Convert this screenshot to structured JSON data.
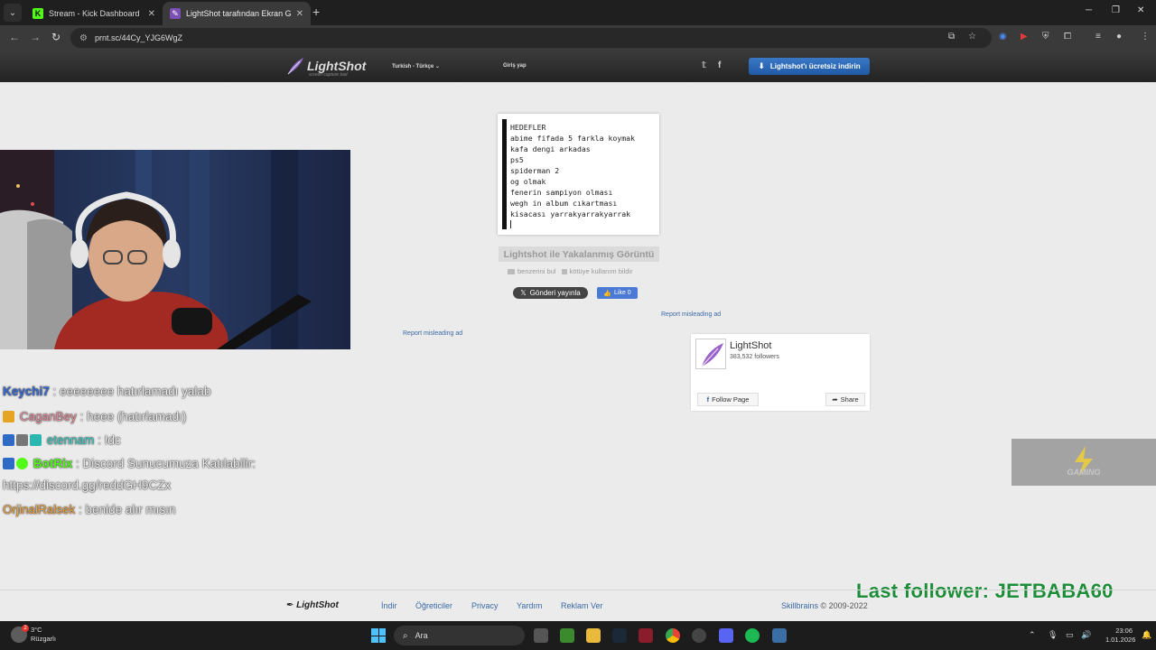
{
  "browser": {
    "tabs": [
      {
        "label": "Stream - Kick Dashboard",
        "active": false
      },
      {
        "label": "LightShot tarafından Ekran Gör",
        "active": true
      }
    ],
    "url": "prnt.sc/44Cy_YJG6WgZ",
    "accent": "#53fc18"
  },
  "lightshot": {
    "logo": "LightShot",
    "logo_sub": "screen capture tool",
    "language": "Turkish - Türkçe",
    "login": "Giriş yap",
    "download": "Lightshot'ı ücretsiz indirin",
    "screenshot_lines": [
      "HEDEFLER",
      "abime fifada 5 farkla koymak",
      "kafa dengi arkadas",
      "ps5",
      "spiderman 2",
      "og olmak",
      "fenerin sampiyon olması",
      "wegh in album cıkartması",
      "kisacası yarrakyarrakyarrak"
    ],
    "caption": "Lightshot ile Yakalanmış Görüntü",
    "find_similar": "benzerini bul",
    "report_abuse": "kötüye kullanım bildir",
    "tweet": "Gönderi yayınla",
    "like": "Like 0",
    "report_ad": "Report misleading ad",
    "fb_widget": {
      "page_name": "LightShot",
      "followers": "383,532 followers",
      "follow": "Follow Page",
      "share": "Share"
    }
  },
  "chat": [
    {
      "user": "Keychi7",
      "message": "eeeeeeee hatırlamadı yalab",
      "color": "#3a6bd1"
    },
    {
      "user": "CaganBey",
      "message": "heee (hatırlamadı)",
      "color": "#e78fa0"
    },
    {
      "user": "etennam",
      "message": "!dc",
      "color": "#3fd0c9"
    },
    {
      "user": "BotRix",
      "message": "Discord Sunucumuza Katılabilir:",
      "color": "#53fc18"
    },
    {
      "user": "",
      "message": "https://discord.gg/reddGH9CZx",
      "color": "#eeeeee"
    },
    {
      "user": "OrjinalRalsek",
      "message": "benide alır mısın",
      "color": "#f0a340"
    }
  ],
  "overlay": {
    "last_follower": "Last follower: JETBABA60",
    "gaming_label": "GAMING"
  },
  "footer": {
    "logo": "LightShot",
    "links": [
      "İndir",
      "Öğreticiler",
      "Privacy",
      "Yardım",
      "Reklam Ver"
    ],
    "brand": "Skillbrains",
    "copy": "© 2009-2022"
  },
  "taskbar": {
    "weather_temp": "3°C",
    "weather_desc": "Rüzgarlı",
    "weather_badge": "2",
    "search": "Ara",
    "time": "23:06",
    "date": "1.01.2026"
  }
}
